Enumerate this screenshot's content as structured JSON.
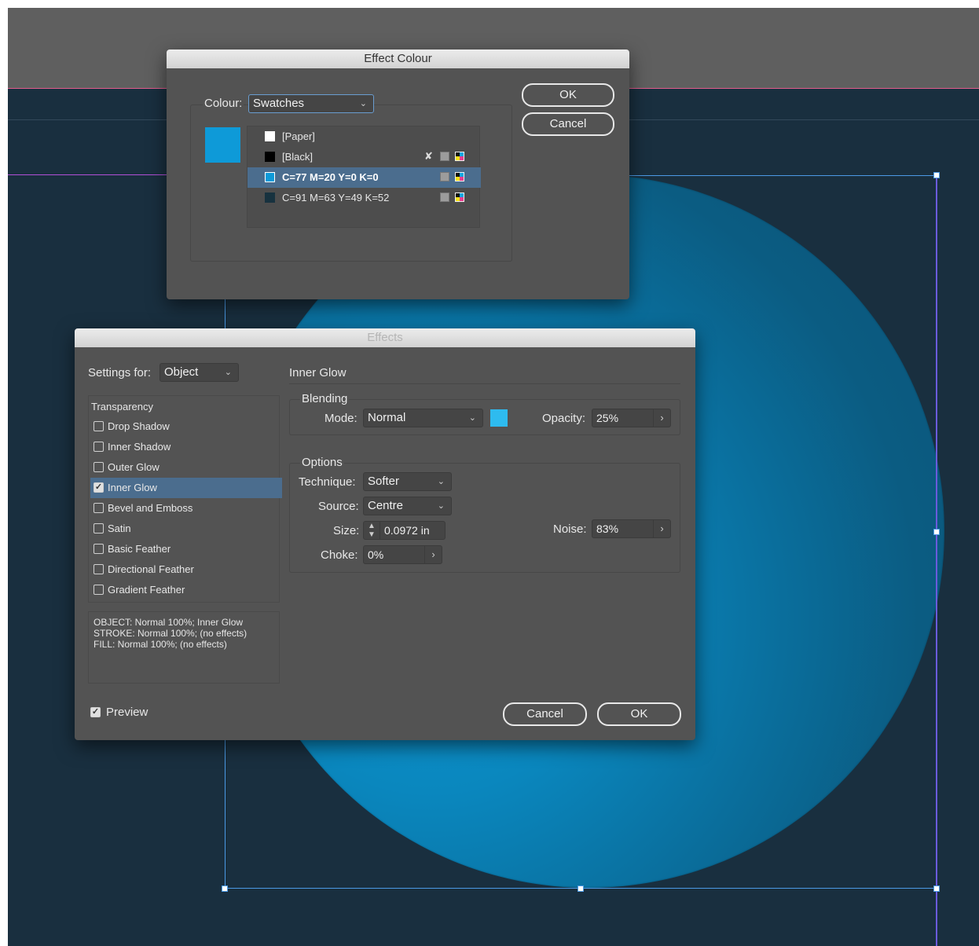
{
  "effect_colour": {
    "title": "Effect Colour",
    "colour_label": "Colour:",
    "colour_value": "Swatches",
    "selected_swatch_color": "#0e9ad8",
    "swatches": [
      {
        "name": "[Paper]",
        "color": "#ffffff"
      },
      {
        "name": "[Black]",
        "color": "#000000"
      },
      {
        "name": "C=77 M=20 Y=0 K=0",
        "color": "#0e9ad8"
      },
      {
        "name": "C=91 M=63 Y=49 K=52",
        "color": "#17323f"
      }
    ],
    "ok": "OK",
    "cancel": "Cancel"
  },
  "effects": {
    "title": "Effects",
    "settings_for_label": "Settings for:",
    "settings_for_value": "Object",
    "list_header": "Transparency",
    "list": [
      {
        "label": "Drop Shadow",
        "checked": false
      },
      {
        "label": "Inner Shadow",
        "checked": false
      },
      {
        "label": "Outer Glow",
        "checked": false
      },
      {
        "label": "Inner Glow",
        "checked": true
      },
      {
        "label": "Bevel and Emboss",
        "checked": false
      },
      {
        "label": "Satin",
        "checked": false
      },
      {
        "label": "Basic Feather",
        "checked": false
      },
      {
        "label": "Directional Feather",
        "checked": false
      },
      {
        "label": "Gradient Feather",
        "checked": false
      }
    ],
    "summary": [
      "OBJECT: Normal 100%; Inner Glow",
      "STROKE: Normal 100%; (no effects)",
      "FILL: Normal 100%; (no effects)"
    ],
    "preview_label": "Preview",
    "section_title": "Inner Glow",
    "blending": {
      "title": "Blending",
      "mode_label": "Mode:",
      "mode_value": "Normal",
      "swatch_color": "#2ebbef",
      "opacity_label": "Opacity:",
      "opacity_value": "25%"
    },
    "options": {
      "title": "Options",
      "technique_label": "Technique:",
      "technique_value": "Softer",
      "source_label": "Source:",
      "source_value": "Centre",
      "size_label": "Size:",
      "size_value": "0.0972 in",
      "choke_label": "Choke:",
      "choke_value": "0%",
      "noise_label": "Noise:",
      "noise_value": "83%"
    },
    "cancel": "Cancel",
    "ok": "OK"
  }
}
